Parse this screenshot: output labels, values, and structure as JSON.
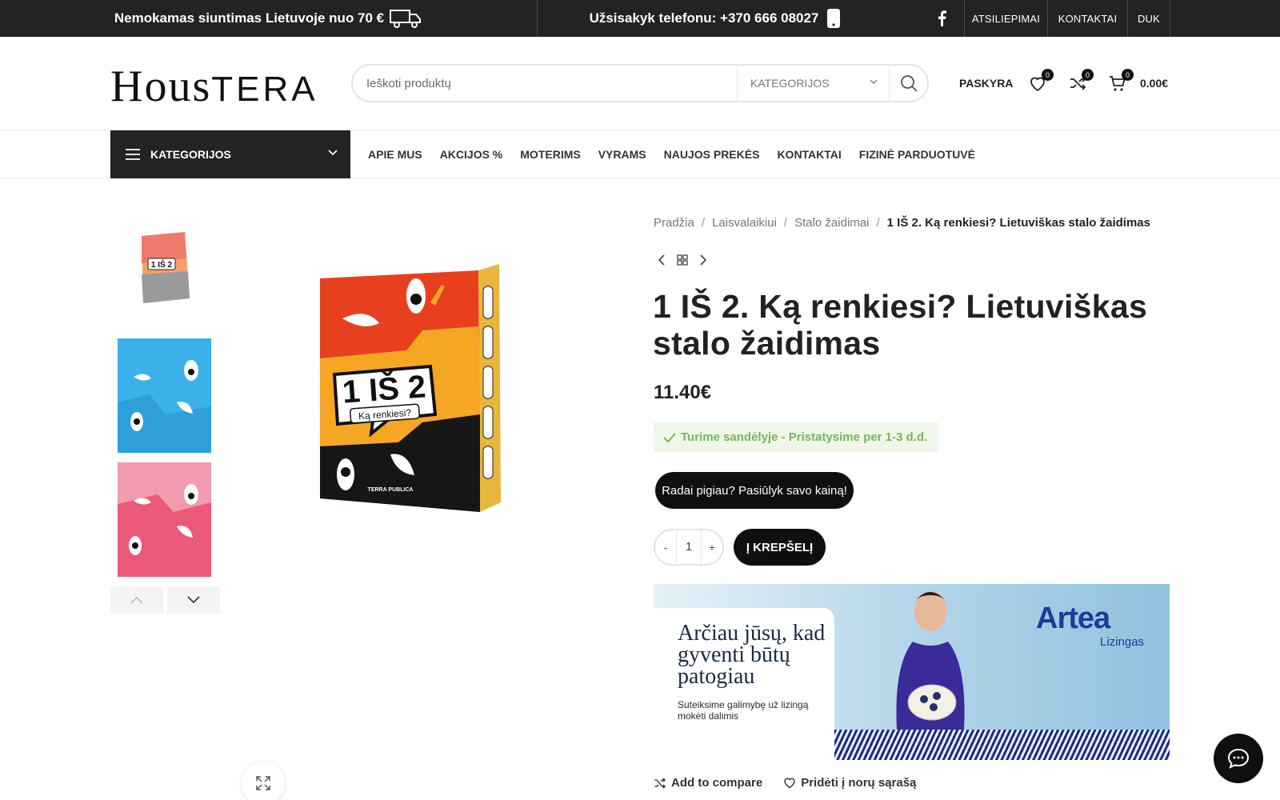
{
  "topbar": {
    "promo": "Nemokamas siuntimas Lietuvoje nuo 70 €",
    "phone": "Užsisakyk telefonu: +370 666 08027",
    "links": [
      "ATSILIEPIMAI",
      "KONTAKTAI",
      "DUK"
    ]
  },
  "header": {
    "logo_part1": "Hous",
    "logo_part2": "TERA",
    "search_placeholder": "Ieškoti produktų",
    "search_category": "KATEGORIJOS",
    "account": "PASKYRA",
    "wishlist_count": "0",
    "compare_count": "0",
    "cart_count": "0",
    "cart_total": "0.00€"
  },
  "nav": {
    "categories_button": "KATEGORIJOS",
    "links": [
      "APIE MUS",
      "AKCIJOS %",
      "MOTERIMS",
      "VYRAMS",
      "NAUJOS PREKĖS",
      "KONTAKTAI",
      "FIZINĖ PARDUOTUVĖ"
    ]
  },
  "gallery": {
    "box_title": "1 IŠ 2",
    "box_subtitle": "Ką renkiesi?",
    "box_publisher": "TERRA PUBLICA",
    "thumb_colors": [
      "#3bb1ea",
      "#ec5a7a"
    ]
  },
  "product": {
    "breadcrumbs": [
      "Pradžia",
      "Laisvalaikiui",
      "Stalo žaidimai"
    ],
    "breadcrumb_current": "1 IŠ 2. Ką renkiesi? Lietuviškas stalo žaidimas",
    "title": "1 IŠ 2. Ką renkiesi? Lietuviškas stalo žaidimas",
    "price": "11.40€",
    "stock": "Turime sandėlyje - Pristatysime per 1-3 d.d.",
    "offer_button": "Radai pigiau? Pasiūlyk savo kainą!",
    "quantity": "1",
    "qty_minus": "-",
    "qty_plus": "+",
    "add_to_cart": "Į KREPŠELĮ",
    "compare": "Add to compare",
    "wishlist": "Pridėti į norų sąrašą"
  },
  "banner": {
    "headline": "Arčiau jūsų, kad gyventi būtų patogiau",
    "subtext": "Suteiksime galimybę už lizingą mokėti dalimis",
    "brand": "Artea",
    "brand_sub": "Lizingas"
  },
  "colors": {
    "dark": "#232323",
    "stock_bg": "#eef7ea",
    "stock_text": "#7ab55c",
    "accent_blue": "#1c3b9a"
  }
}
